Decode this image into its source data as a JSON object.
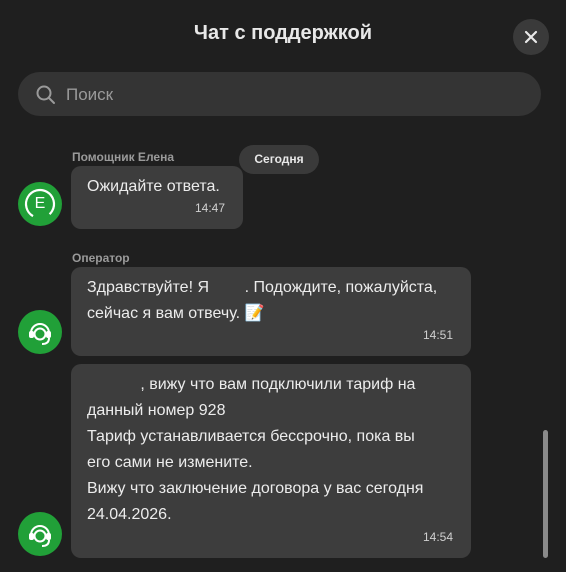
{
  "header": {
    "title": "Чат с поддержкой",
    "close_icon": "close-icon"
  },
  "search": {
    "placeholder": "Поиск",
    "value": ""
  },
  "date_chip": "Сегодня",
  "messages": [
    {
      "sender": "Помощник Елена",
      "avatar_letter": "E",
      "text": "Ожидайте ответа.",
      "time": "14:47"
    },
    {
      "sender": "Оператор",
      "text": "Здравствуйте! Я        . Подождите, пожалуйста,\nсейчас я вам отвечу. 📝",
      "time": "14:51"
    },
    {
      "text": "            , вижу что вам подключили тариф на\nданный номер 928\nТариф устанавливается бессрочно, пока вы\nего сами не измените.\nВижу что заключение договора у вас сегодня\n24.04.2026.",
      "time": "14:54"
    }
  ],
  "colors": {
    "background": "#1f1f1f",
    "bubble": "#3d3d3d",
    "accent": "#21a038"
  }
}
